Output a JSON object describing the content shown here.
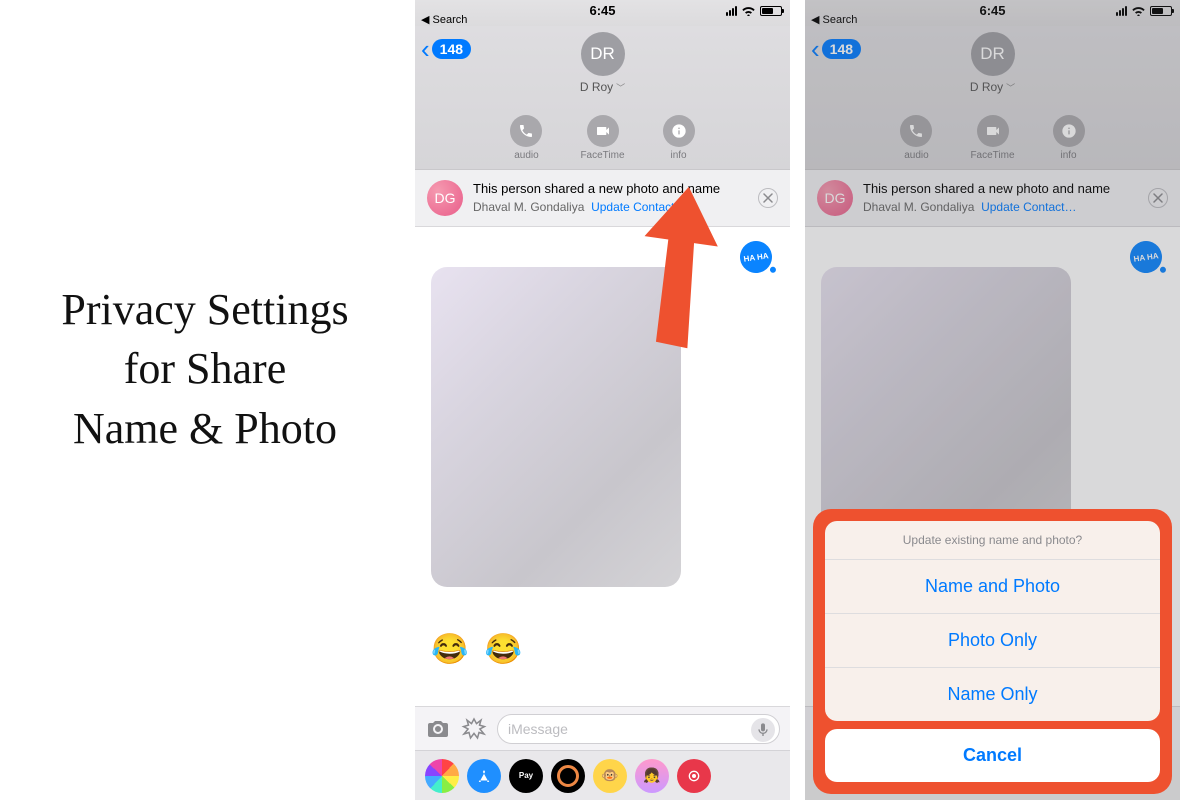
{
  "heading": {
    "line1": "Privacy Settings",
    "line2": "for Share",
    "line3": "Name & Photo"
  },
  "statusbar": {
    "time": "6:45",
    "back_label": "Search"
  },
  "nav": {
    "back_count": "148",
    "avatar_initials": "DR",
    "contact_name": "D Roy",
    "actions": {
      "audio": "audio",
      "facetime": "FaceTime",
      "info": "info"
    }
  },
  "banner": {
    "avatar_initials": "DG",
    "title": "This person shared a new photo and name",
    "subtitle_name": "Dhaval M. Gondaliya",
    "link_label": "Update Contact…"
  },
  "chat": {
    "haha_label": "HA HA",
    "emoji_text": "😂 😂"
  },
  "input": {
    "placeholder": "iMessage"
  },
  "app_strip": {
    "pay_label": "Pay"
  },
  "sheet": {
    "title": "Update existing name and photo?",
    "opt1": "Name and Photo",
    "opt2": "Photo Only",
    "opt3": "Name Only",
    "cancel": "Cancel"
  },
  "colors": {
    "ios_blue": "#007aff",
    "arrow": "#ee512f"
  }
}
